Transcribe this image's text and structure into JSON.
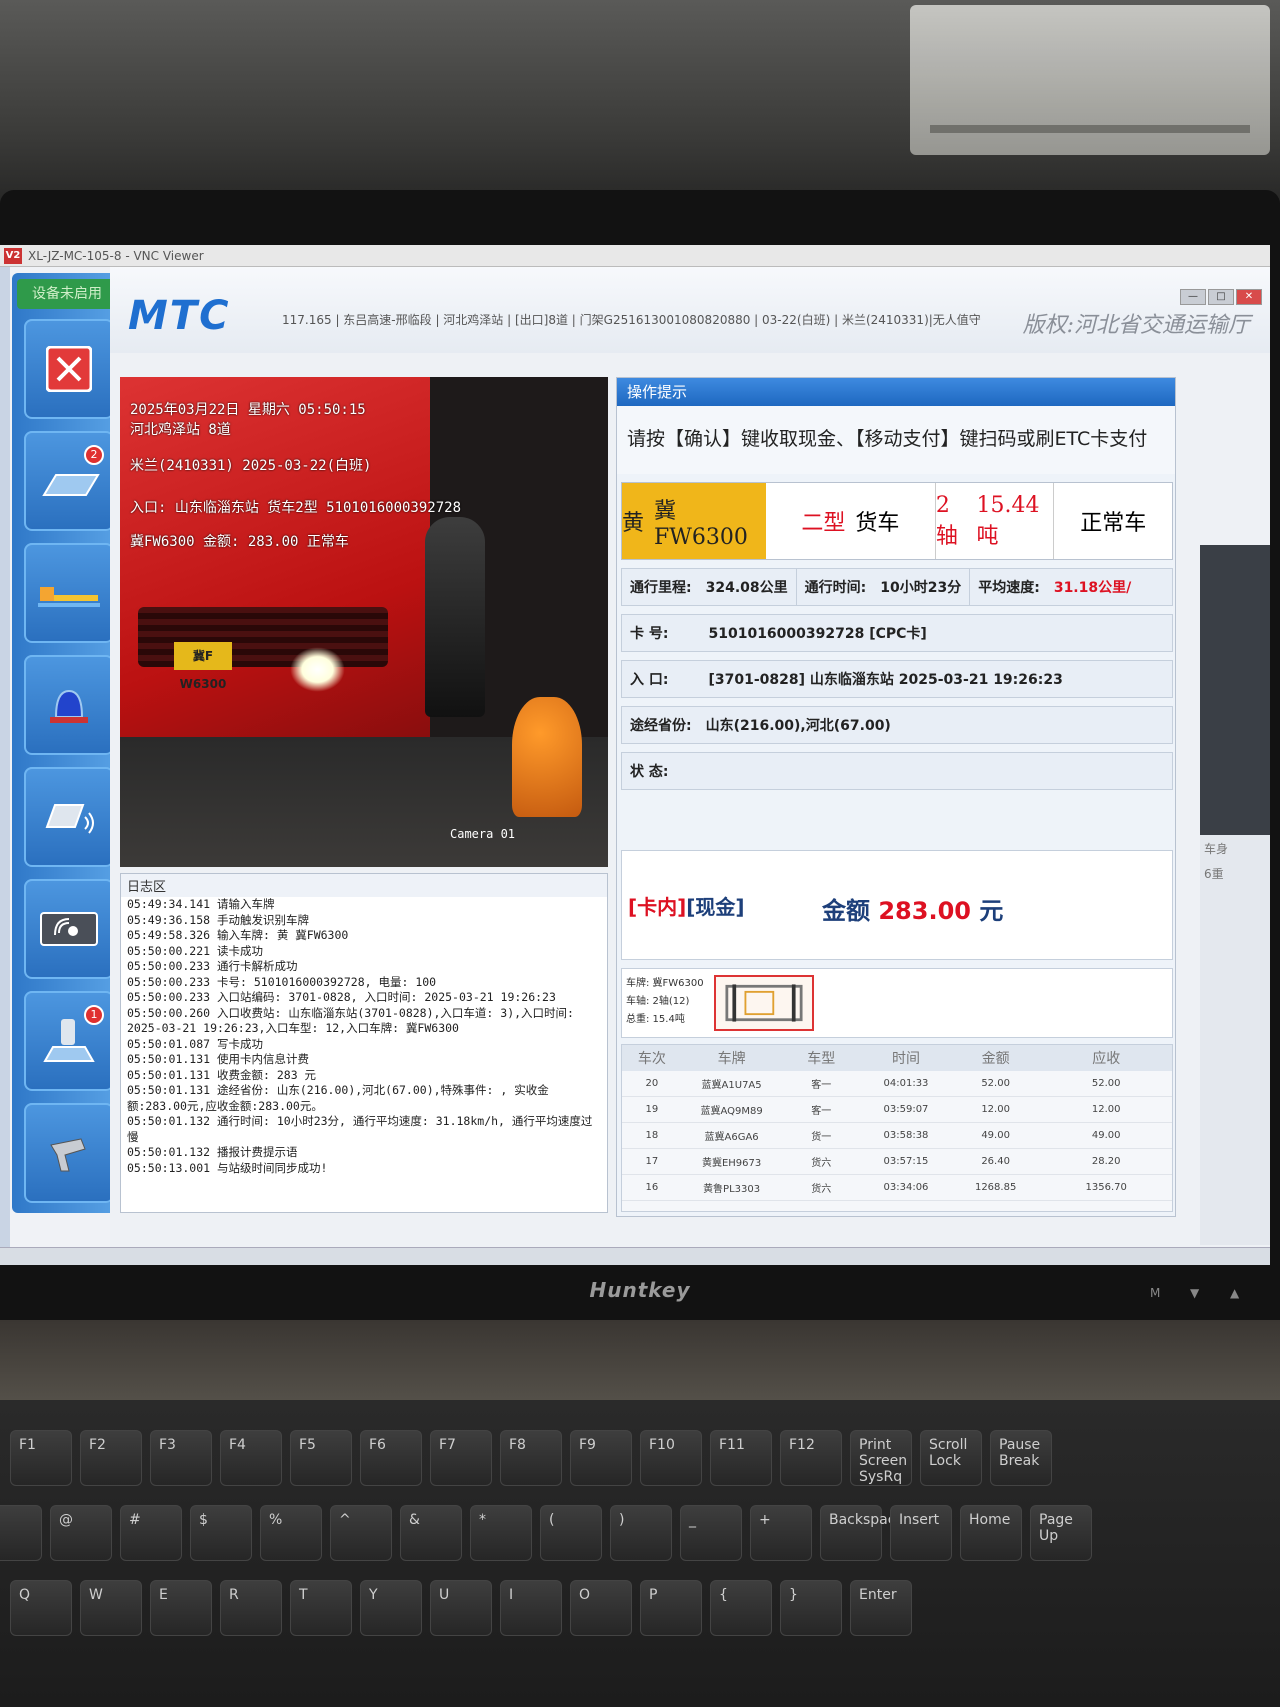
{
  "surroundings": {
    "monitor_brand": "Huntkey",
    "monitor_buttons": [
      "M",
      "▼",
      "▲"
    ]
  },
  "vnc": {
    "logo": "V2",
    "title": "XL-JZ-MC-105-8 - VNC Viewer"
  },
  "sidebar": {
    "status_label": "设备未启用",
    "badges": {
      "card": "2",
      "vehicle": "1"
    },
    "icons": [
      "close-icon",
      "card-reader-icon",
      "barrier-gate-icon",
      "alarm-light-icon",
      "etc-card-icon",
      "wireless-pay-icon",
      "vehicle-queue-icon",
      "scanner-icon"
    ]
  },
  "header": {
    "logo": "MTC",
    "info": "117.165 | 东吕高速-邢临段 | 河北鸡泽站 | [出口]8道 | 门架G251613001080820880 | 03-22(白班) | 米兰(2410331)|无人值守",
    "copyright": "版权:河北省交通运输厅",
    "window_buttons": [
      "—",
      "□",
      "✕"
    ]
  },
  "camera": {
    "overlay_lines": [
      "2025年03月22日 星期六 05:50:15",
      "河北鸡泽站 8道",
      "米兰(2410331) 2025-03-22(白班)",
      "入口: 山东临淄东站 货车2型 5101016000392728",
      "冀FW6300 金额: 283.00 正常车"
    ],
    "plate": "冀F W6300",
    "label": "Camera 01"
  },
  "log": {
    "title": "日志区",
    "lines": [
      "05:49:34.141 请输入车牌",
      "05:49:36.158 手动触发识别车牌",
      "05:49:58.326 输入车牌: 黄 冀FW6300",
      "05:50:00.221 读卡成功",
      "05:50:00.233 通行卡解析成功",
      "05:50:00.233 卡号: 5101016000392728, 电量: 100",
      "05:50:00.233 入口站编码: 3701-0828, 入口时间: 2025-03-21 19:26:23",
      "05:50:00.260 入口收费站: 山东临淄东站(3701-0828),入口车道: 3),入口时间: 2025-03-21 19:26:23,入口车型: 12,入口车牌: 冀FW6300",
      "05:50:01.087 写卡成功",
      "05:50:01.131 使用卡内信息计费",
      "05:50:01.131 收费金额: 283 元",
      "05:50:01.131 途经省份: 山东(216.00),河北(67.00),特殊事件: , 实收金额:283.00元,应收金额:283.00元。",
      "05:50:01.132 通行时间: 10小时23分, 通行平均速度: 31.18km/h, 通行平均速度过慢",
      "05:50:01.132 播报计费提示语",
      "05:50:13.001 与站级时间同步成功!"
    ]
  },
  "operation": {
    "title": "操作提示",
    "hint": "请按【确认】键收取现金、【移动支付】键扫码或刷ETC卡支付"
  },
  "vehicle": {
    "plate_color": "黄",
    "plate": "冀FW6300",
    "class": "二型",
    "type": "货车",
    "axles": "2轴",
    "weight": "15.44吨",
    "status": "正常车"
  },
  "trip": {
    "distance_label": "通行里程:",
    "distance": "324.08公里",
    "time_label": "通行时间:",
    "time": "10小时23分",
    "speed_label": "平均速度:",
    "speed": "31.18公里/",
    "card_label": "卡 号:",
    "card": "5101016000392728 [CPC卡]",
    "entry_label": "入 口:",
    "entry": "[3701-0828] 山东临淄东站 2025-03-21 19:26:23",
    "provinces_label": "途经省份:",
    "provinces": "山东(216.00),河北(67.00)",
    "state_label": "状 态:",
    "state": ""
  },
  "payment": {
    "source": "[卡内]",
    "method": "[现金]",
    "amount_label": "金额",
    "amount": "283.00",
    "unit": "元"
  },
  "axle": {
    "plate_line": "车牌: 冀FW6300",
    "axle_line": "车轴: 2轴(12)",
    "weight_line": "总重: 15.4吨"
  },
  "history": {
    "columns": [
      "车次",
      "车牌",
      "车型",
      "时间",
      "金额",
      "应收"
    ],
    "rows": [
      [
        "20",
        "蓝冀A1U7A5",
        "客一",
        "04:01:33",
        "52.00",
        "52.00"
      ],
      [
        "19",
        "蓝冀AQ9M89",
        "客一",
        "03:59:07",
        "12.00",
        "12.00"
      ],
      [
        "18",
        "蓝冀A6GA6",
        "货一",
        "03:58:38",
        "49.00",
        "49.00"
      ],
      [
        "17",
        "黄冀EH9673",
        "货六",
        "03:57:15",
        "26.40",
        "28.20"
      ],
      [
        "16",
        "黄鲁PL3303",
        "货六",
        "03:34:06",
        "1268.85",
        "1356.70"
      ]
    ]
  },
  "right_panel": {
    "label1": "车身",
    "label2": "6重"
  },
  "keyboard": {
    "row1": [
      "F1",
      "F2",
      "F3",
      "F4",
      "F5",
      "F6",
      "F7",
      "F8",
      "F9",
      "F10",
      "F11",
      "F12",
      "Print Screen SysRq",
      "Scroll Lock",
      "Pause Break"
    ],
    "row2": [
      "!",
      "@",
      "#",
      "$",
      "%",
      "^",
      "&",
      "*",
      "(",
      ")",
      "_",
      "+",
      "Backspace",
      "Insert",
      "Home",
      "Page Up"
    ],
    "row3": [
      "Q",
      "W",
      "E",
      "R",
      "T",
      "Y",
      "U",
      "I",
      "O",
      "P",
      "{",
      "}",
      "Enter"
    ]
  }
}
